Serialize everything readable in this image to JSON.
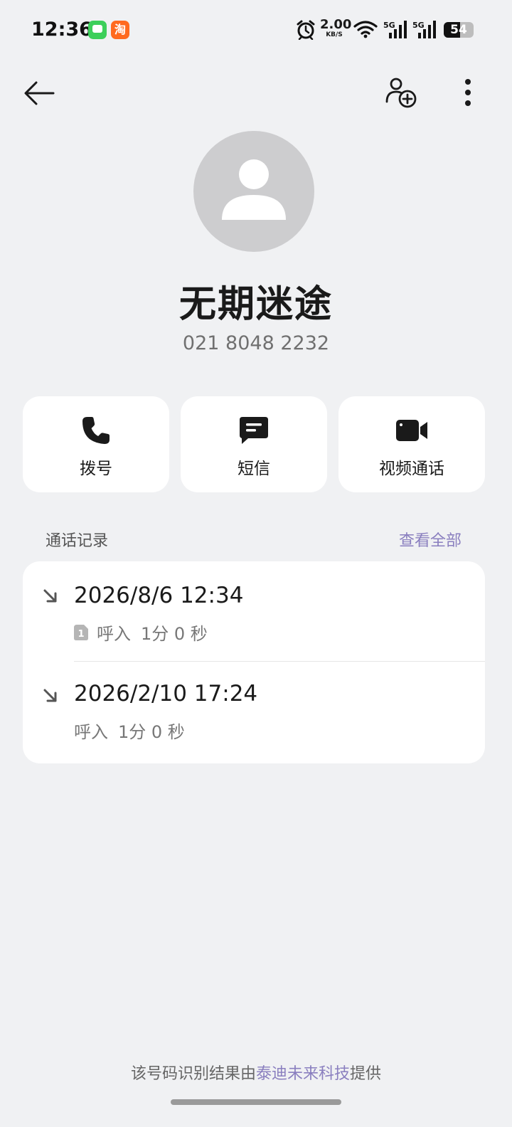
{
  "status_bar": {
    "time": "12:36",
    "taobao_glyph": "淘",
    "net_speed_value": "2.00",
    "net_speed_unit": "KB/S",
    "signal_1_label": "5G",
    "signal_2_label": "5G",
    "battery_level": 54,
    "battery_text": "54"
  },
  "header": {
    "back_icon": "arrow-left-icon",
    "add_contact_icon": "person-add-icon",
    "more_icon": "more-vertical-icon"
  },
  "contact": {
    "avatar_icon": "person-icon",
    "name": "无期迷途",
    "number": "021 8048 2232"
  },
  "actions": [
    {
      "label": "拨号",
      "icon": "phone-icon"
    },
    {
      "label": "短信",
      "icon": "message-icon"
    },
    {
      "label": "视频通话",
      "icon": "video-camera-icon"
    }
  ],
  "call_log": {
    "title": "通话记录",
    "view_all": "查看全部",
    "entries": [
      {
        "datetime": "2026/8/6 12:34",
        "sim": "1",
        "direction": "呼入",
        "duration": "1分 0 秒",
        "direction_icon": "incoming-arrow-icon"
      },
      {
        "datetime": "2026/2/10 17:24",
        "direction": "呼入",
        "duration": "1分 0 秒",
        "direction_icon": "incoming-arrow-icon"
      }
    ]
  },
  "footer": {
    "prefix": "该号码识别结果由",
    "brand": "泰迪未来科技",
    "suffix": "提供"
  },
  "colors": {
    "background": "#f0f1f3",
    "card": "#ffffff",
    "accent": "#8a7fbf",
    "avatar_bg": "#cdcdcf"
  }
}
